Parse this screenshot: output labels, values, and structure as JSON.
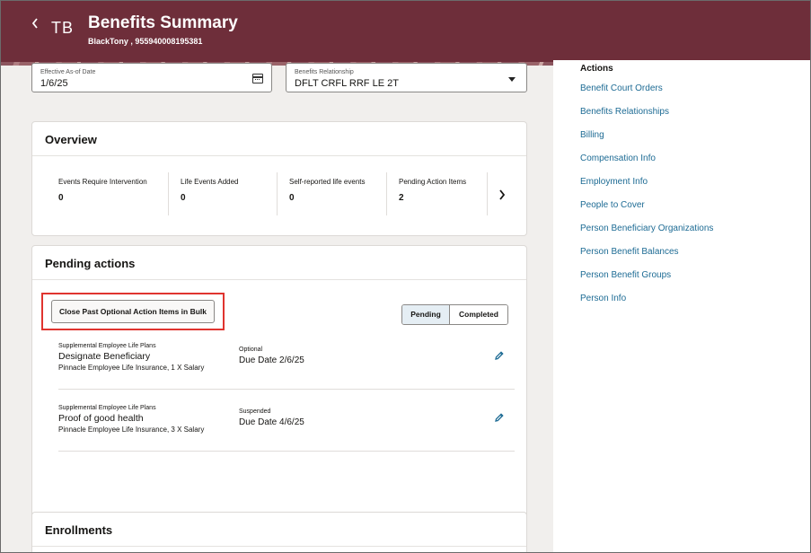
{
  "header": {
    "back_icon": "chevron-left-icon",
    "avatar_initials": "TB",
    "title": "Benefits Summary",
    "subtitle": "BlackTony , 955940008195381",
    "color": "#6e2e3a"
  },
  "filters": {
    "effective_date": {
      "label": "Effective As-of Date",
      "value": "1/6/25",
      "icon": "calendar-icon"
    },
    "relationship": {
      "label": "Benefits Relationship",
      "value": "DFLT CRFL RRF LE 2T",
      "icon": "chevron-down-icon"
    }
  },
  "overview": {
    "title": "Overview",
    "metrics": [
      {
        "label": "Events Require Intervention",
        "value": "0"
      },
      {
        "label": "Life Events Added",
        "value": "0"
      },
      {
        "label": "Self-reported life events",
        "value": "0"
      },
      {
        "label": "Pending Action Items",
        "value": "2"
      }
    ],
    "next_icon": "chevron-right-icon"
  },
  "pending_actions": {
    "title": "Pending actions",
    "bulk_button_label": "Close Past Optional Action Items in Bulk",
    "tabs": [
      {
        "label": "Pending",
        "selected": true
      },
      {
        "label": "Completed",
        "selected": false
      }
    ],
    "items": [
      {
        "plan": "Supplemental Employee Life Plans",
        "title": "Designate Beneficiary",
        "detail": "Pinnacle Employee Life Insurance, 1 X Salary",
        "status": "Optional",
        "due": "Due Date 2/6/25"
      },
      {
        "plan": "Supplemental Employee Life Plans",
        "title": "Proof of good health",
        "detail": "Pinnacle Employee Life Insurance, 3 X Salary",
        "status": "Suspended",
        "due": "Due Date 4/6/25"
      }
    ],
    "highlight_color": "#e0342f"
  },
  "enrollments": {
    "title": "Enrollments"
  },
  "actions_panel": {
    "heading": "Actions",
    "links": [
      "Benefit Court Orders",
      "Benefits Relationships",
      "Billing",
      "Compensation Info",
      "Employment Info",
      "People to Cover",
      "Person Beneficiary Organizations",
      "Person Benefit Balances",
      "Person Benefit Groups",
      "Person Info"
    ],
    "link_color": "#1d6b94"
  }
}
